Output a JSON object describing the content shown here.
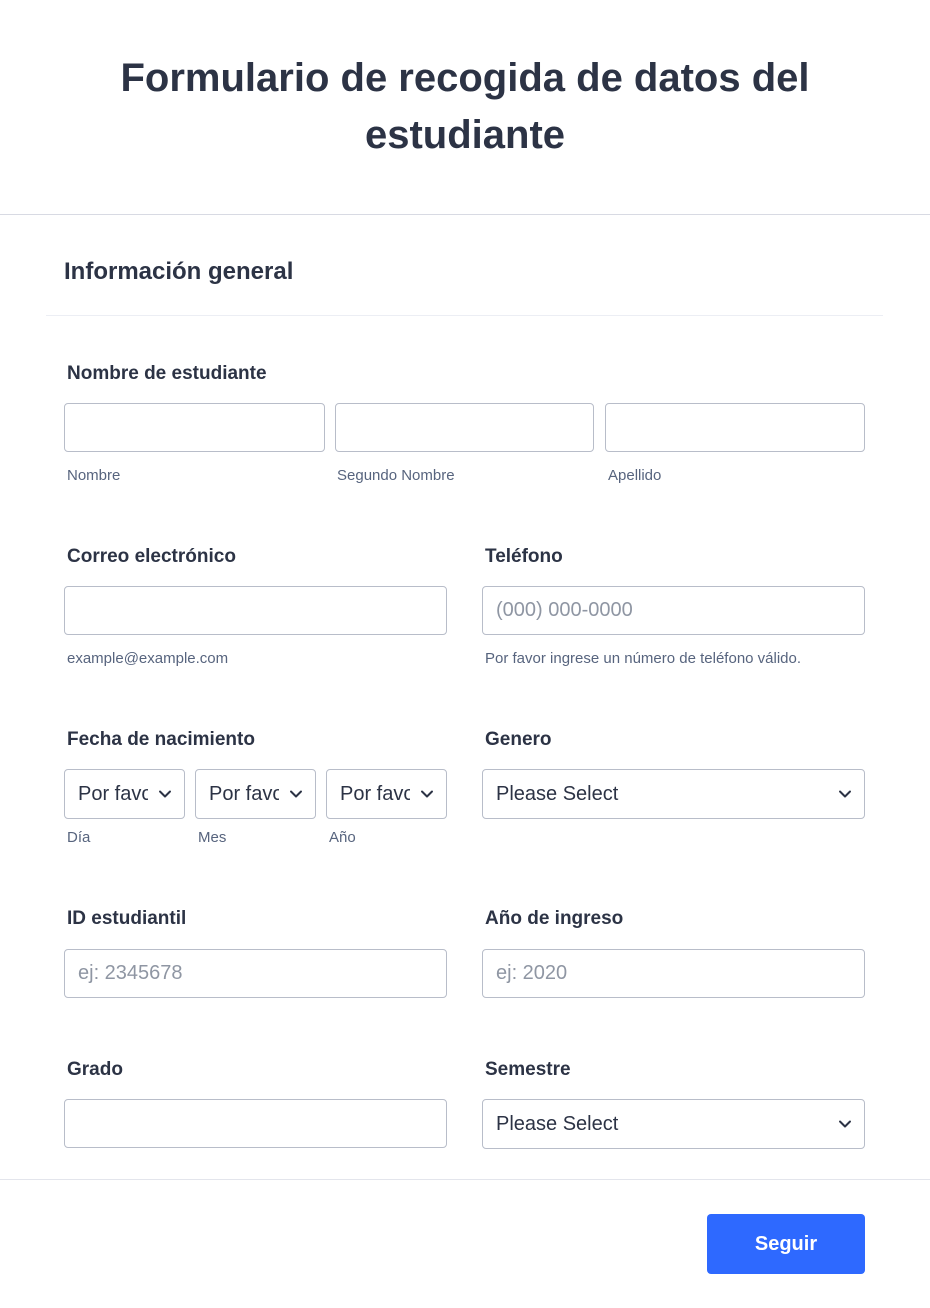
{
  "header": {
    "title": "Formulario de recogida de datos del estudiante"
  },
  "section": {
    "title": "Información general"
  },
  "student_name": {
    "label": "Nombre de estudiante",
    "first_sublabel": "Nombre",
    "middle_sublabel": "Segundo Nombre",
    "last_sublabel": "Apellido"
  },
  "email": {
    "label": "Correo electrónico",
    "sublabel": "example@example.com"
  },
  "phone": {
    "label": "Teléfono",
    "placeholder": "(000) 000-0000",
    "sublabel": "Por favor ingrese un número de teléfono válido."
  },
  "birth_date": {
    "label": "Fecha de nacimiento",
    "day_value": "Por favor",
    "month_value": "Por favor",
    "year_value": "Por favor",
    "day_sublabel": "Día",
    "month_sublabel": "Mes",
    "year_sublabel": "Año"
  },
  "gender": {
    "label": "Genero",
    "value": "Please Select"
  },
  "student_id": {
    "label": "ID estudiantil",
    "placeholder": "ej: 2345678"
  },
  "entry_year": {
    "label": "Año de ingreso",
    "placeholder": "ej: 2020"
  },
  "grade": {
    "label": "Grado"
  },
  "semester": {
    "label": "Semestre",
    "value": "Please Select"
  },
  "footer": {
    "submit_label": "Seguir"
  },
  "colors": {
    "accent": "#2e69ff",
    "text": "#2c3345",
    "muted": "#57647e",
    "border": "#b8bdc9"
  },
  "icons": {
    "select_arrow": "chevron-down-icon"
  }
}
